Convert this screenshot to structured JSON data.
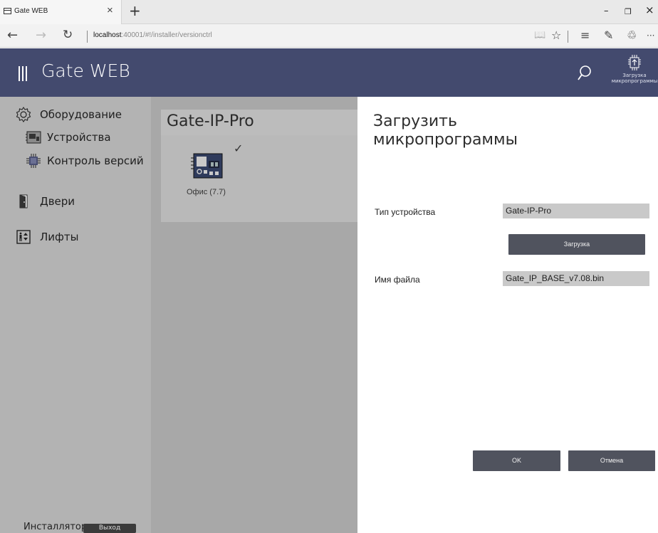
{
  "browser": {
    "tab_title": "Gate WEB",
    "tab_close": "×",
    "new_tab": "+",
    "url_host": "localhost",
    "url_rest": ":40001/#!/installer/versionctrl",
    "win_min": "–",
    "win_max": "❐",
    "win_close": "×",
    "back": "←",
    "forward": "→",
    "refresh": "↻",
    "reading_view": "📖",
    "favorite": "☆",
    "hub": "≡",
    "notes": "✎",
    "share": "♲",
    "more": "···"
  },
  "header": {
    "app_title": "Gate WEB",
    "upload_tool_label": "Загрузка микропрограммы"
  },
  "sidebar": {
    "items": [
      {
        "label": "Оборудование",
        "icon": "gear-icon"
      },
      {
        "label": "Устройства",
        "icon": "device-board-icon"
      },
      {
        "label": "Контроль версий",
        "icon": "chip-icon"
      },
      {
        "label": "Двери",
        "icon": "door-icon"
      },
      {
        "label": "Лифты",
        "icon": "elevator-icon"
      }
    ],
    "footer_user": "Инсталлятор",
    "logout_label": "Выход"
  },
  "main": {
    "group_title": "Gate-IP-Pro",
    "device_label": "Офис (7.7)",
    "check": "✓"
  },
  "dialog": {
    "title": "Загрузить микропрограммы",
    "device_type_label": "Тип устройства",
    "device_type_value": "Gate-IP-Pro",
    "upload_button": "Загрузка",
    "file_name_label": "Имя файла",
    "file_name_value": "Gate_IP_BASE_v7.08.bin",
    "ok_button": "OK",
    "cancel_button": "Отмена"
  },
  "colors": {
    "header_bg": "#434a6e",
    "sidebar_bg": "#b3b3b3",
    "button_dark": "#50535e"
  }
}
